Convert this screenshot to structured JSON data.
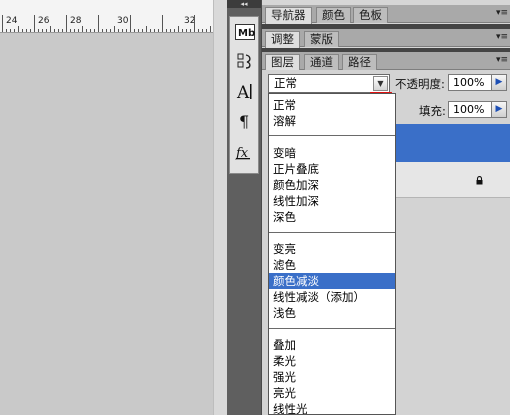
{
  "ruler": {
    "labels": [
      "24",
      "26",
      "28",
      "30",
      "32"
    ]
  },
  "tool_strip": {
    "tools": [
      {
        "icon": "mini-bridge-icon",
        "glyph": "Mb"
      },
      {
        "icon": "brush-icon",
        "glyph": "✎"
      },
      {
        "icon": "character-icon",
        "glyph": "A|"
      },
      {
        "icon": "paragraph-icon",
        "glyph": "¶"
      },
      {
        "icon": "styles-icon",
        "glyph": "fx"
      }
    ]
  },
  "panels": {
    "group1_tabs": [
      "导航器",
      "颜色",
      "色板"
    ],
    "group2_tabs": [
      "调整",
      "蒙版"
    ],
    "group3_tabs": [
      "图层",
      "通道",
      "路径"
    ],
    "opacity_label": "不透明度:",
    "opacity_value": "100%",
    "fill_label": "填充:",
    "fill_value": "100%"
  },
  "blend_mode": {
    "selected": "正常",
    "dropdown_icon": "chevron-down-icon",
    "groups": [
      [
        "正常",
        "溶解"
      ],
      [
        "变暗",
        "正片叠底",
        "颜色加深",
        "线性加深",
        "深色"
      ],
      [
        "变亮",
        "滤色",
        "颜色减淡",
        "线性减淡（添加）",
        "浅色"
      ],
      [
        "叠加",
        "柔光",
        "强光",
        "亮光",
        "线性光"
      ]
    ],
    "highlighted": "颜色减淡"
  },
  "colors": {
    "highlight": "#3a6fc8",
    "annotation": "#e01010"
  }
}
